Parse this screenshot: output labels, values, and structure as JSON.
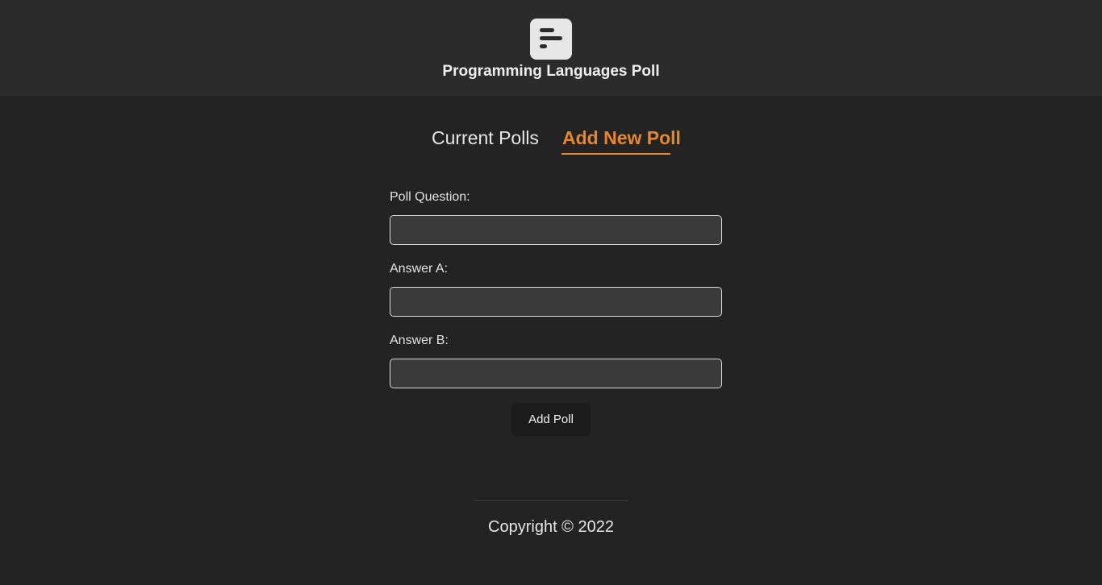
{
  "header": {
    "logo_icon": "poll-bars-icon",
    "title": "Programming Languages Poll"
  },
  "tabs": [
    {
      "label": "Current Polls",
      "active": false
    },
    {
      "label": "Add New Poll",
      "active": true
    }
  ],
  "form": {
    "question_label": "Poll Question:",
    "question_value": "",
    "answer_a_label": "Answer A:",
    "answer_a_value": "",
    "answer_b_label": "Answer B:",
    "answer_b_value": "",
    "submit_label": "Add Poll"
  },
  "footer": {
    "copyright": "Copyright © 2022"
  },
  "colors": {
    "accent": "#e8862a",
    "background": "#232323",
    "header_background": "#2b2b2b"
  }
}
